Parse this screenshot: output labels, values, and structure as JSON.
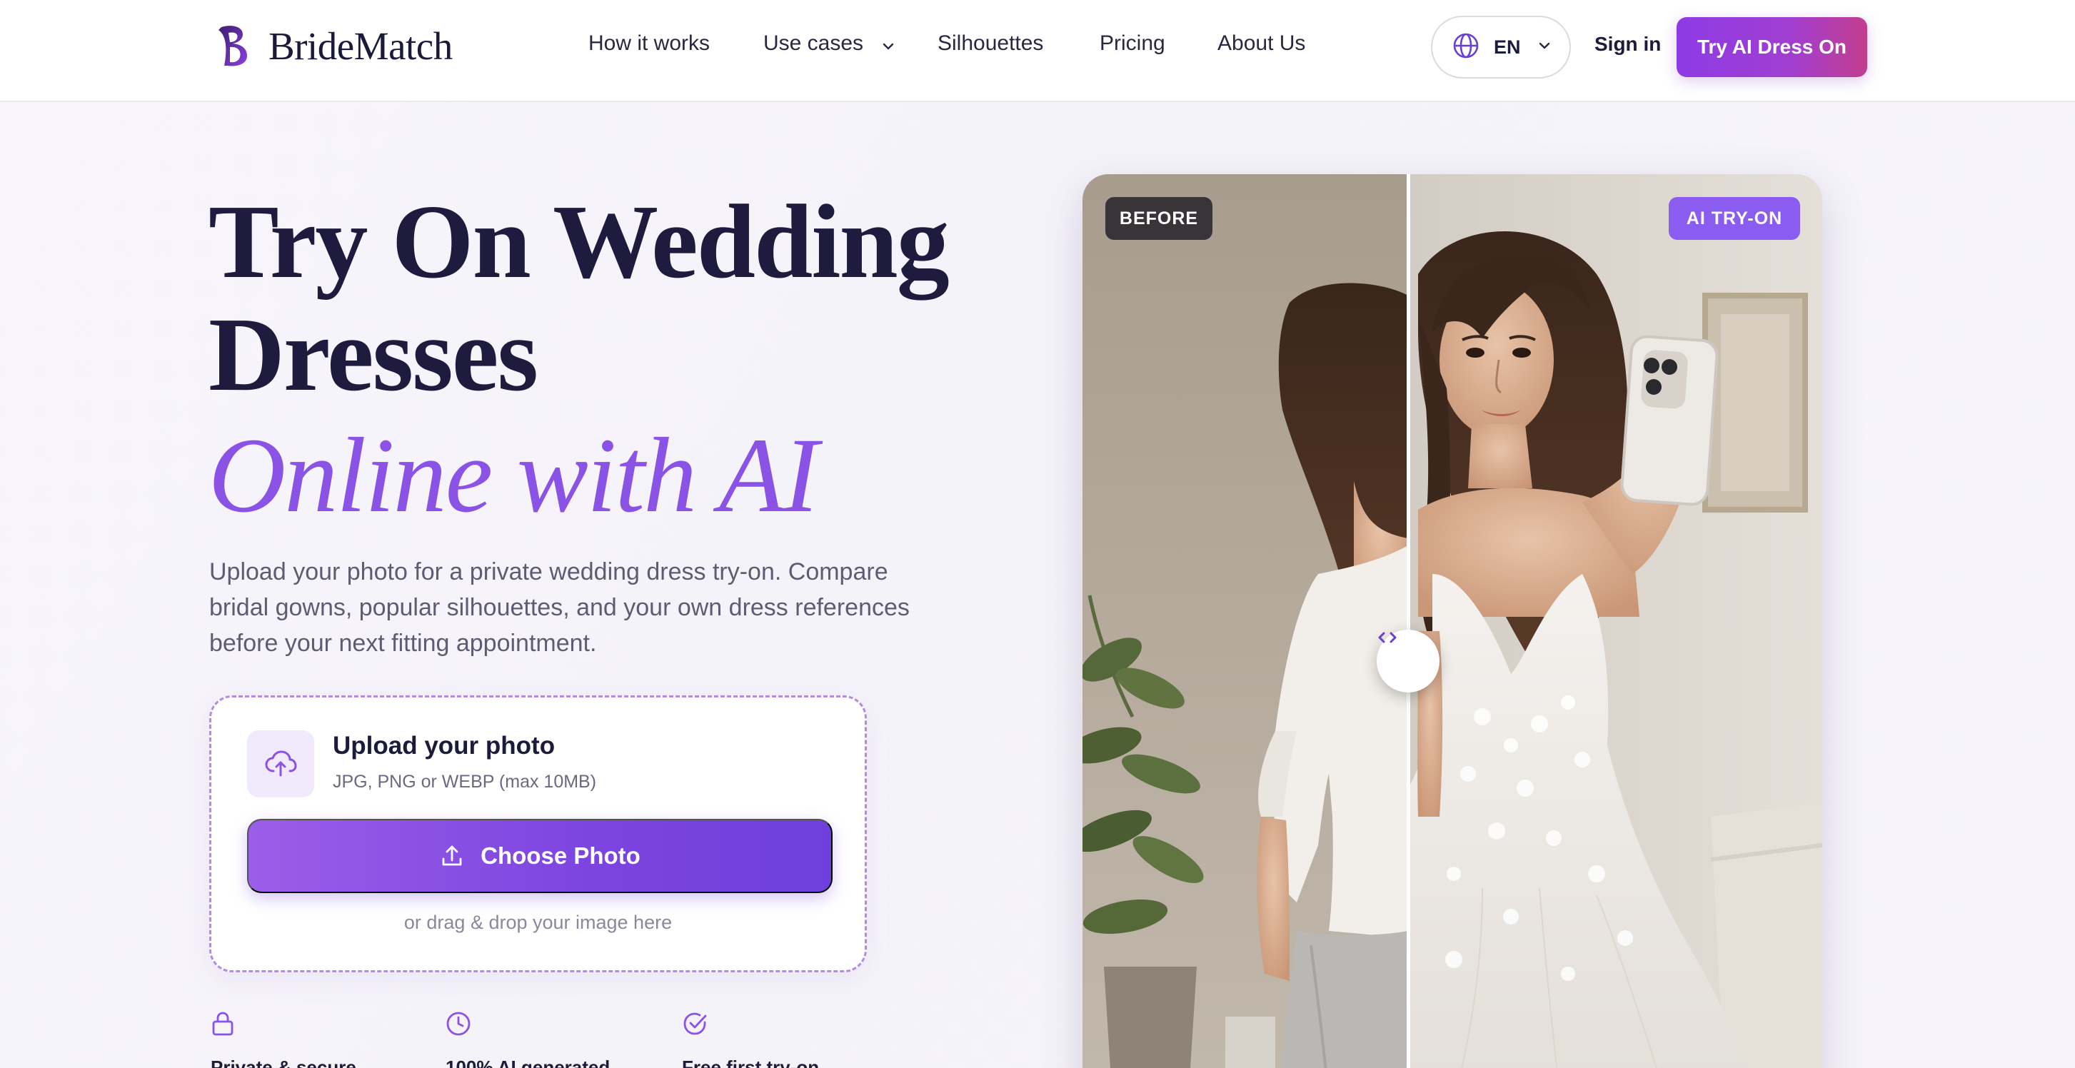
{
  "brand": {
    "name": "BrideMatch"
  },
  "nav": {
    "links": [
      "How it works",
      "Use cases",
      "Silhouettes",
      "Pricing",
      "About Us"
    ],
    "language": "EN",
    "signin": "Sign in",
    "cta": "Try AI Dress On"
  },
  "hero": {
    "title_line1": "Try On Wedding",
    "title_line2": "Dresses",
    "title_accent": "Online with AI",
    "description": "Upload your photo for a private wedding dress try-on. Compare bridal gowns, popular silhouettes, and your own dress references before your next fitting appointment."
  },
  "upload": {
    "title": "Upload your photo",
    "formats": "JPG, PNG or WEBP (max 10MB)",
    "button": "Choose Photo",
    "hint": "or drag & drop your image here"
  },
  "features": [
    {
      "icon": "lock-icon",
      "label": "Private & secure"
    },
    {
      "icon": "clock-icon",
      "label": "100% AI generated"
    },
    {
      "icon": "check-circle-icon",
      "label": "Free first try-on"
    }
  ],
  "compare": {
    "before_label": "BEFORE",
    "after_label": "AI TRY-ON"
  },
  "colors": {
    "accent": "#8b52e6",
    "cta_gradient_start": "#8d3be6",
    "cta_gradient_end": "#c23e8e",
    "title": "#1e1b3e"
  }
}
